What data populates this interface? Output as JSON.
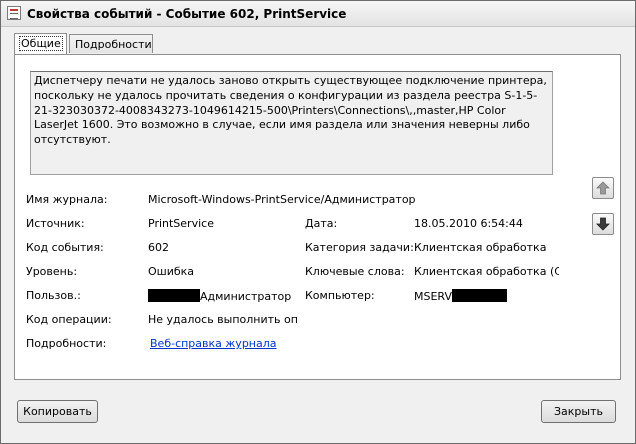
{
  "window": {
    "title": "Свойства событий - Событие 602, PrintService"
  },
  "tabs": [
    {
      "label": "Общие",
      "active": true
    },
    {
      "label": "Подробности",
      "active": false
    }
  ],
  "description": "Диспетчеру печати не удалось заново открыть существующее подключение принтера, поскольку не удалось прочитать сведения о конфигурации из раздела реестра S-1-5-21-323030372-4008343273-1049614215-500\\Printers\\Connections\\,,master,HP Color LaserJet 1600. Это возможно в случае, если имя раздела или значения неверны либо отсутствуют.",
  "fields": {
    "log_name": {
      "label": "Имя журнала:",
      "value": "Microsoft-Windows-PrintService/Администратор"
    },
    "source": {
      "label": "Источник:",
      "value": "PrintService"
    },
    "date": {
      "label": "Дата:",
      "value": "18.05.2010 6:54:44"
    },
    "event_id": {
      "label": "Код события:",
      "value": "602"
    },
    "task_category": {
      "label": "Категория задачи:",
      "value": "Клиентская обработка"
    },
    "level": {
      "label": "Уровень:",
      "value": "Ошибка"
    },
    "keywords": {
      "label": "Ключевые слова:",
      "value": "Клиентская обработка (CS"
    },
    "user": {
      "label": "Пользов.:",
      "value": "Администратор"
    },
    "computer": {
      "label": "Компьютер:",
      "value": "MSERV"
    },
    "opcode": {
      "label": "Код операции:",
      "value": "Не удалось выполнить опе"
    },
    "more_info": {
      "label": "Подробности:",
      "link": "Веб-справка журнала"
    }
  },
  "nav": {
    "up_icon": "arrow-up-icon",
    "down_icon": "arrow-down-icon"
  },
  "buttons": {
    "copy": "Копировать",
    "close": "Закрыть"
  }
}
